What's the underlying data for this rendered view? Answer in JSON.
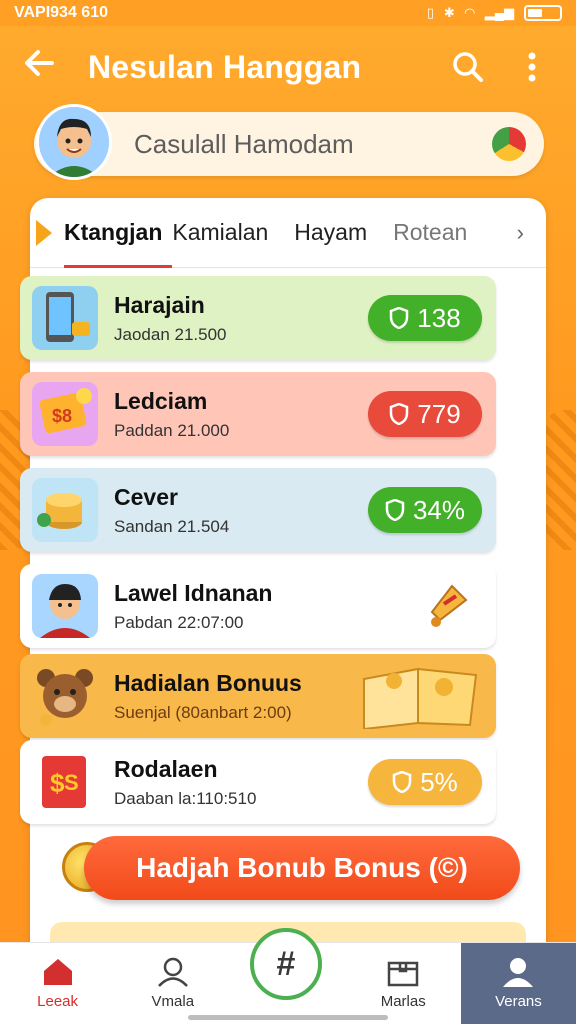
{
  "status_bar": {
    "time": "VAPI934 610"
  },
  "header": {
    "title": "Nesulan Hanggan"
  },
  "profile": {
    "name": "Casulall Hamodam"
  },
  "tabs": [
    {
      "label": "Ktangjan"
    },
    {
      "label": "Kamialan"
    },
    {
      "label": "Hayam"
    },
    {
      "label": "Rotean"
    }
  ],
  "items": [
    {
      "name": "Harajain",
      "sub": "Jaodan 21.500",
      "value": "138",
      "bg": "#dff2c3",
      "pill": "#43b02a"
    },
    {
      "name": "Ledciam",
      "sub": "Paddan 21.000",
      "value": "779",
      "bg": "#ffc6b8",
      "pill": "#e84b3c"
    },
    {
      "name": "Cever",
      "sub": "Sandan 21.504",
      "value": "34%",
      "bg": "#d9eaf3",
      "pill": "#43b02a"
    },
    {
      "name": "Lawel Idnanan",
      "sub": "Pabdan 22:07:00",
      "value": "",
      "bg": "#ffffff",
      "pill": ""
    },
    {
      "name": "Hadialan Bonuus",
      "sub": "Suenjal (80anbart 2:00)",
      "value": "",
      "bg": "#f9b84a",
      "pill": ""
    },
    {
      "name": "Rodalaen",
      "sub": "Daaban la:110:510",
      "value": "5%",
      "bg": "#ffffff",
      "pill": "#f6b63e"
    }
  ],
  "cta": {
    "label": "Hadjah Bonub Bonus (©)"
  },
  "nav": [
    {
      "label": "Leeak"
    },
    {
      "label": "Vmala"
    },
    {
      "label": "Marlas"
    },
    {
      "label": "Verans"
    }
  ]
}
